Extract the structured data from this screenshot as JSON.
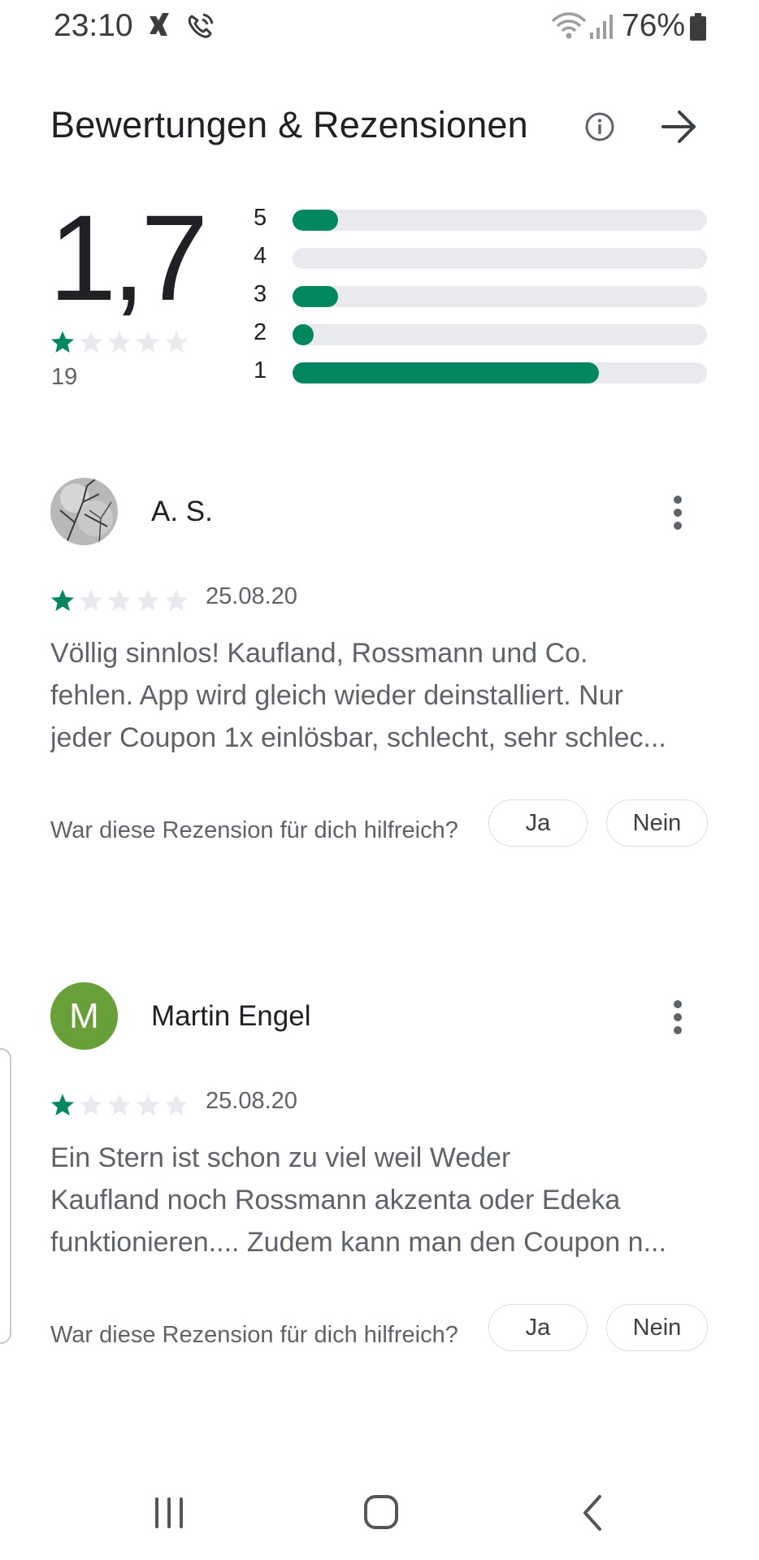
{
  "status_bar": {
    "time": "23:10",
    "battery": "76%"
  },
  "header": {
    "title": "Bewertungen & Rezensionen"
  },
  "summary": {
    "average": "1,7",
    "count": "19",
    "stars": 1.7,
    "distribution": [
      {
        "label": "5",
        "fraction": 0.11
      },
      {
        "label": "4",
        "fraction": 0.0
      },
      {
        "label": "3",
        "fraction": 0.11
      },
      {
        "label": "2",
        "fraction": 0.05
      },
      {
        "label": "1",
        "fraction": 0.74
      }
    ]
  },
  "reviews": [
    {
      "author": "A. S.",
      "date": "25.08.20",
      "rating": 1,
      "lines": [
        "Völlig sinnlos! Kaufland, Rossmann und Co.",
        "fehlen. App wird gleich wieder deinstalliert. Nur",
        "jeder Coupon 1x einlösbar, schlecht, sehr schlec..."
      ],
      "helpful_question": "War diese Rezension für dich hilfreich?",
      "yes": "Ja",
      "no": "Nein"
    },
    {
      "author": "Martin Engel",
      "avatar_letter": "M",
      "date": "25.08.20",
      "rating": 1,
      "lines": [
        "Ein Stern ist schon zu viel weil Weder",
        "Kaufland noch Rossmann akzenta oder Edeka",
        "funktionieren.... Zudem kann man den Coupon n..."
      ],
      "helpful_question": "War diese Rezension für dich hilfreich?",
      "yes": "Ja",
      "no": "Nein"
    }
  ],
  "colors": {
    "accent": "#01875f",
    "track": "#e8eaed",
    "avatar_green": "#689f38"
  }
}
